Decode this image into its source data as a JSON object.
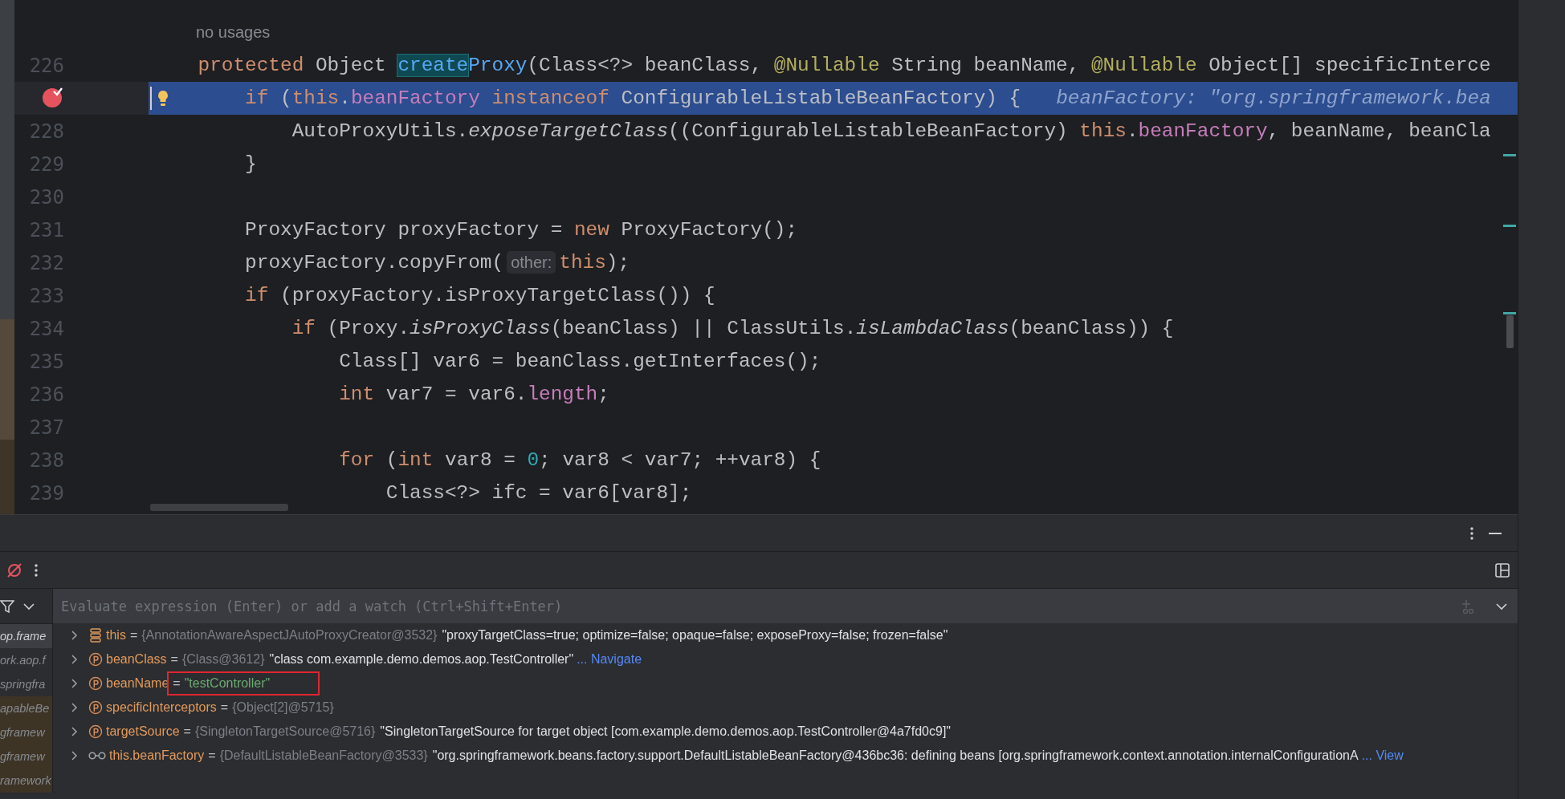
{
  "editor": {
    "lines": [
      {
        "kind": "inlay",
        "text": "no usages"
      },
      {
        "kind": "code",
        "number": "226",
        "breakpoint": false,
        "current": false,
        "tokens": [
          {
            "text": "protected ",
            "kind": "keyword"
          },
          {
            "text": "Object ",
            "kind": "plain"
          },
          {
            "text": "create",
            "kind": "usage"
          },
          {
            "text": "Proxy",
            "kind": "declaration"
          },
          {
            "text": "(Class<?> beanClass, ",
            "kind": "plain"
          },
          {
            "text": "@Nullable ",
            "kind": "annotation"
          },
          {
            "text": "String beanName, ",
            "kind": "plain"
          },
          {
            "text": "@Nullable ",
            "kind": "annotation"
          },
          {
            "text": "Object[] specificInterce",
            "kind": "plain"
          }
        ]
      },
      {
        "kind": "code",
        "breakpoint": true,
        "current": true,
        "tokens": [
          {
            "text": "if ",
            "kind": "keyword"
          },
          {
            "text": "(",
            "kind": "plain"
          },
          {
            "text": "this",
            "kind": "keyword"
          },
          {
            "text": ".",
            "kind": "plain"
          },
          {
            "text": "beanFactory",
            "kind": "field"
          },
          {
            "text": " instanceof",
            "kind": "keyword"
          },
          {
            "text": " ConfigurableListableBeanFactory) {",
            "kind": "plain"
          },
          {
            "text": "beanFactory: \"org.springframework.bea",
            "kind": "inline_value"
          }
        ]
      },
      {
        "kind": "code",
        "number": "228",
        "breakpoint": false,
        "current": false,
        "tokens": [
          {
            "text": "AutoProxyUtils.",
            "kind": "plain"
          },
          {
            "text": "exposeTargetClass",
            "kind": "static"
          },
          {
            "text": "((ConfigurableListableBeanFactory) ",
            "kind": "plain"
          },
          {
            "text": "this",
            "kind": "keyword"
          },
          {
            "text": ".",
            "kind": "plain"
          },
          {
            "text": "beanFactory",
            "kind": "field"
          },
          {
            "text": ", beanName, beanCla",
            "kind": "plain"
          }
        ]
      },
      {
        "kind": "code",
        "number": "229",
        "breakpoint": false,
        "current": false,
        "tokens": [
          {
            "text": "}",
            "kind": "plain"
          }
        ]
      },
      {
        "kind": "code",
        "number": "230",
        "breakpoint": false,
        "current": false
      },
      {
        "kind": "code",
        "number": "231",
        "breakpoint": false,
        "current": false,
        "tokens": [
          {
            "text": "ProxyFactory proxyFactory = ",
            "kind": "plain"
          },
          {
            "text": "new",
            "kind": "keyword"
          },
          {
            "text": " ProxyFactory();",
            "kind": "plain"
          }
        ]
      },
      {
        "kind": "code",
        "number": "232",
        "breakpoint": false,
        "current": false,
        "tokens": [
          {
            "text": "proxyFactory.copyFrom(",
            "kind": "plain"
          },
          {
            "text": "other:",
            "kind": "param_hint"
          },
          {
            "text": "this",
            "kind": "keyword"
          },
          {
            "text": ");",
            "kind": "plain"
          }
        ]
      },
      {
        "kind": "code",
        "number": "233",
        "breakpoint": false,
        "current": false,
        "tokens": [
          {
            "text": "if",
            "kind": "keyword"
          },
          {
            "text": " (proxyFactory.isProxyTargetClass()) {",
            "kind": "plain"
          }
        ]
      },
      {
        "kind": "code",
        "number": "234",
        "breakpoint": false,
        "current": false,
        "tokens": [
          {
            "text": "if",
            "kind": "keyword"
          },
          {
            "text": " (Proxy.",
            "kind": "plain"
          },
          {
            "text": "isProxyClass",
            "kind": "static"
          },
          {
            "text": "(beanClass) || ClassUtils.",
            "kind": "plain"
          },
          {
            "text": "isLambdaClass",
            "kind": "static"
          },
          {
            "text": "(beanClass)) {",
            "kind": "plain"
          }
        ]
      },
      {
        "kind": "code",
        "number": "235",
        "breakpoint": false,
        "current": false,
        "tokens": [
          {
            "text": "Class[] var6 = beanClass.getInterfaces();",
            "kind": "plain"
          }
        ]
      },
      {
        "kind": "code",
        "number": "236",
        "breakpoint": false,
        "current": false,
        "tokens": [
          {
            "text": "int",
            "kind": "keyword"
          },
          {
            "text": " var7 = var6.",
            "kind": "plain"
          },
          {
            "text": "length",
            "kind": "field"
          },
          {
            "text": ";",
            "kind": "plain"
          }
        ]
      },
      {
        "kind": "code",
        "number": "237",
        "breakpoint": false,
        "current": false
      },
      {
        "kind": "code",
        "number": "238",
        "breakpoint": false,
        "current": false,
        "tokens": [
          {
            "text": "for",
            "kind": "keyword"
          },
          {
            "text": " (",
            "kind": "plain"
          },
          {
            "text": "int",
            "kind": "keyword"
          },
          {
            "text": " var8 = ",
            "kind": "plain"
          },
          {
            "text": "0",
            "kind": "number"
          },
          {
            "text": "; var8 < var7; ++var8) {",
            "kind": "plain"
          }
        ]
      },
      {
        "kind": "code",
        "number": "239",
        "breakpoint": false,
        "current": false,
        "tokens": [
          {
            "text": "Class<?> ifc = var6[var8];",
            "kind": "plain"
          }
        ]
      }
    ]
  },
  "debugger": {
    "watch_field": {
      "placeholder": "Evaluate expression (Enter) or add a watch (Ctrl+Shift+Enter)"
    },
    "frames": [
      {
        "text": "op.frame",
        "selected": true,
        "library": false
      },
      {
        "text": "ork.aop.f",
        "selected": false,
        "library": false
      },
      {
        "text": "springfra",
        "selected": false,
        "library": false
      },
      {
        "text": "apableBe",
        "selected": false,
        "library": true
      },
      {
        "text": "gframew",
        "selected": false,
        "library": true
      },
      {
        "text": "gframew",
        "selected": false,
        "library": true
      },
      {
        "text": "ramework",
        "selected": false,
        "library": true
      }
    ],
    "variables": [
      {
        "kind": "field",
        "name": "this",
        "separator": "=",
        "type": "{AnnotationAwareAspectJAutoProxyCreator@3532}",
        "value": {
          "kind": "object",
          "text": "\"proxyTargetClass=true; optimize=false; opaque=false; exposeProxy=false; frozen=false\""
        },
        "boxed": false
      },
      {
        "kind": "parameter",
        "name": "beanClass",
        "separator": "=",
        "type": "{Class@3612}",
        "value": {
          "kind": "object",
          "text": "\"class com.example.demo.demos.aop.TestController\""
        },
        "link": "... Navigate",
        "boxed": false
      },
      {
        "kind": "parameter",
        "name": "beanName",
        "separator": "=",
        "value": {
          "kind": "string",
          "text": "\"testController\""
        },
        "boxed": true
      },
      {
        "kind": "parameter",
        "name": "specificInterceptors",
        "separator": "=",
        "type": "{Object[2]@5715}",
        "boxed": false
      },
      {
        "kind": "parameter",
        "name": "targetSource",
        "separator": "=",
        "type": "{SingletonTargetSource@5716}",
        "value": {
          "kind": "object",
          "text": "\"SingletonTargetSource for target object [com.example.demo.demos.aop.TestController@4a7fd0c9]\""
        },
        "boxed": false
      },
      {
        "kind": "watch",
        "name": "this.beanFactory",
        "separator": "=",
        "type": "{DefaultListableBeanFactory@3533}",
        "value": {
          "kind": "object",
          "text": "\"org.springframework.beans.factory.support.DefaultListableBeanFactory@436bc36: defining beans [org.springframework.context.annotation.internalConfigurationA"
        },
        "link": "... View",
        "boxed": false
      }
    ]
  }
}
